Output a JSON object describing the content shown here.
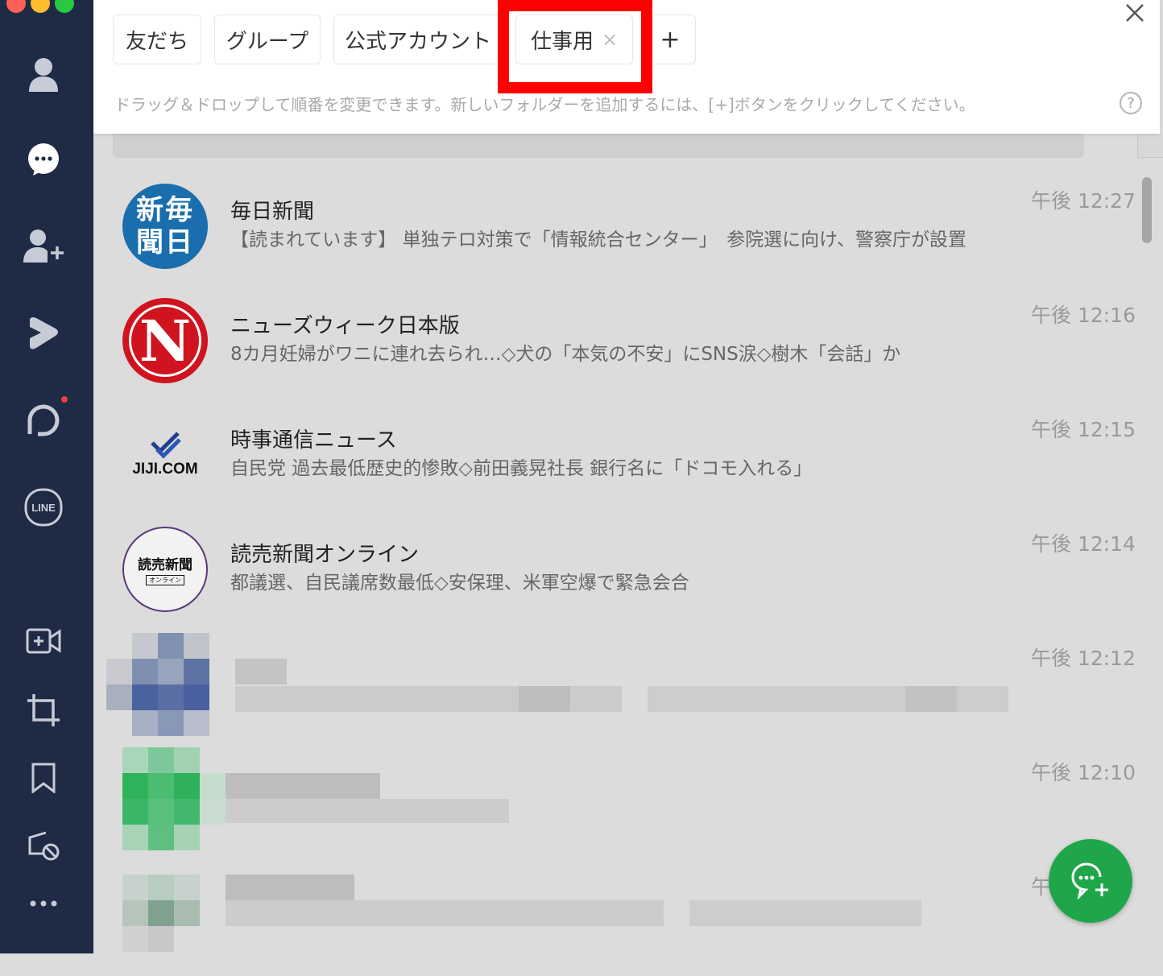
{
  "folders": {
    "tabs": [
      {
        "label": "友だち"
      },
      {
        "label": "グループ"
      },
      {
        "label": "公式アカウント"
      },
      {
        "label": "仕事用",
        "close": "×"
      }
    ],
    "add_label": "+",
    "hint": "ドラッグ＆ドロップして順番を変更できます。新しいフォルダーを追加するには、[+]ボタンをクリックしてください。",
    "help": "?"
  },
  "chats": [
    {
      "name": "毎日新聞",
      "message": "【読まれています】 単独テロ対策で「情報統合センター」　参院選に向け、警察庁が設置",
      "time": "午後 12:27",
      "avatar_text": "新毎聞日",
      "avatar_color": "#1a6eae"
    },
    {
      "name": "ニューズウィーク日本版",
      "message": "8カ月妊婦がワニに連れ去られ…◇犬の「本気の不安」にSNS涙◇樹木「会話」か",
      "time": "午後 12:16",
      "avatar_text": "N",
      "avatar_color": "#d0141f"
    },
    {
      "name": "時事通信ニュース",
      "message": "自民党 過去最低歴史的惨敗◇前田義晃社長 銀行名に「ドコモ入れる」",
      "time": "午後 12:15",
      "avatar_text": "JIJI.COM"
    },
    {
      "name": "読売新聞オンライン",
      "message": "都議選、自民議席数最低◇安保理、米軍空爆で緊急会合",
      "time": "午後 12:14",
      "avatar_text": "読売新聞",
      "avatar_sub": "オンライン"
    },
    {
      "time": "午後 12:12"
    },
    {
      "time": "午後 12:10"
    },
    {
      "time": "午"
    }
  ],
  "sidebar_line_label": "LINE"
}
